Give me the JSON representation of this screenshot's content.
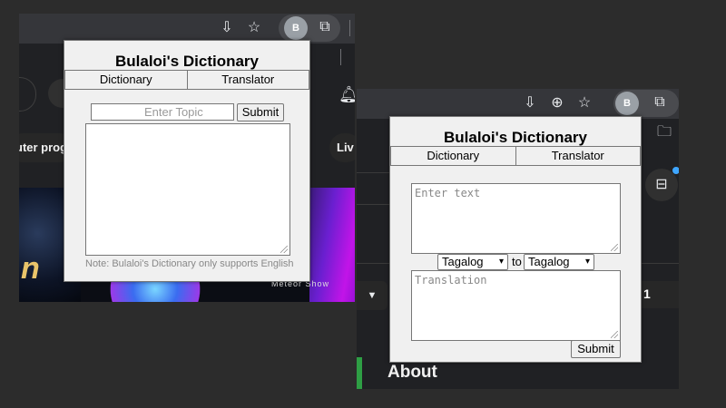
{
  "popup": {
    "title": "Bulaloi's Dictionary",
    "tabs": [
      "Dictionary",
      "Translator"
    ]
  },
  "dictionary": {
    "topic_placeholder": "Enter Topic",
    "submit_label": "Submit",
    "note": "Note: Bulaloi's Dictionary only supports English"
  },
  "translator": {
    "input_placeholder": "Enter text",
    "source_language": "Tagalog",
    "to_label": "to",
    "target_language": "Tagalog",
    "output_placeholder": "Translation",
    "submit_label": "Submit"
  },
  "browser": {
    "avatar_letter": "B"
  },
  "background_page": {
    "left_chip_text": "uter prog",
    "left_chip_text_2": "Liv",
    "thumbnail_text": "Meteor Show",
    "thumbnail_glyph": "n",
    "about_label": "About",
    "count_badge": "1"
  },
  "colors": {
    "popup_bg": "#f0f0f0",
    "page_bg": "#202124",
    "backdrop": "#2c2c2c"
  }
}
